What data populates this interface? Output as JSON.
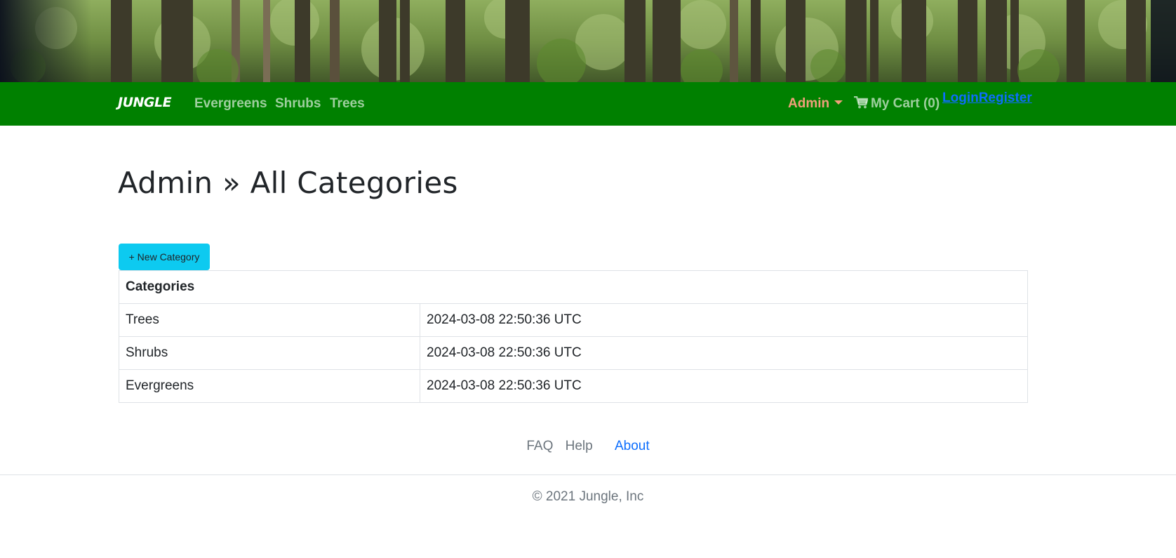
{
  "header": {
    "banner_alt": "forest-banner",
    "brand": "JUNGLE",
    "nav_links": [
      "Evergreens",
      "Shrubs",
      "Trees"
    ],
    "admin_label": "Admin",
    "cart_label": "My Cart (0)",
    "login_label": "Login",
    "register_label": "Register",
    "colors": {
      "navbar": "#008000",
      "admin": "#f0a07a",
      "link": "#0d6efd"
    }
  },
  "main": {
    "title": "Admin » All Categories",
    "new_button_label": "+ New Category",
    "table": {
      "header": "Categories",
      "rows": [
        {
          "name": "Trees",
          "created": "2024-03-08 22:50:36 UTC"
        },
        {
          "name": "Shrubs",
          "created": "2024-03-08 22:50:36 UTC"
        },
        {
          "name": "Evergreens",
          "created": "2024-03-08 22:50:36 UTC"
        }
      ]
    },
    "button_color": "#0dcaf0"
  },
  "footer": {
    "links": [
      "FAQ",
      "Help",
      "About"
    ],
    "copyright": "© 2021 Jungle, Inc"
  }
}
